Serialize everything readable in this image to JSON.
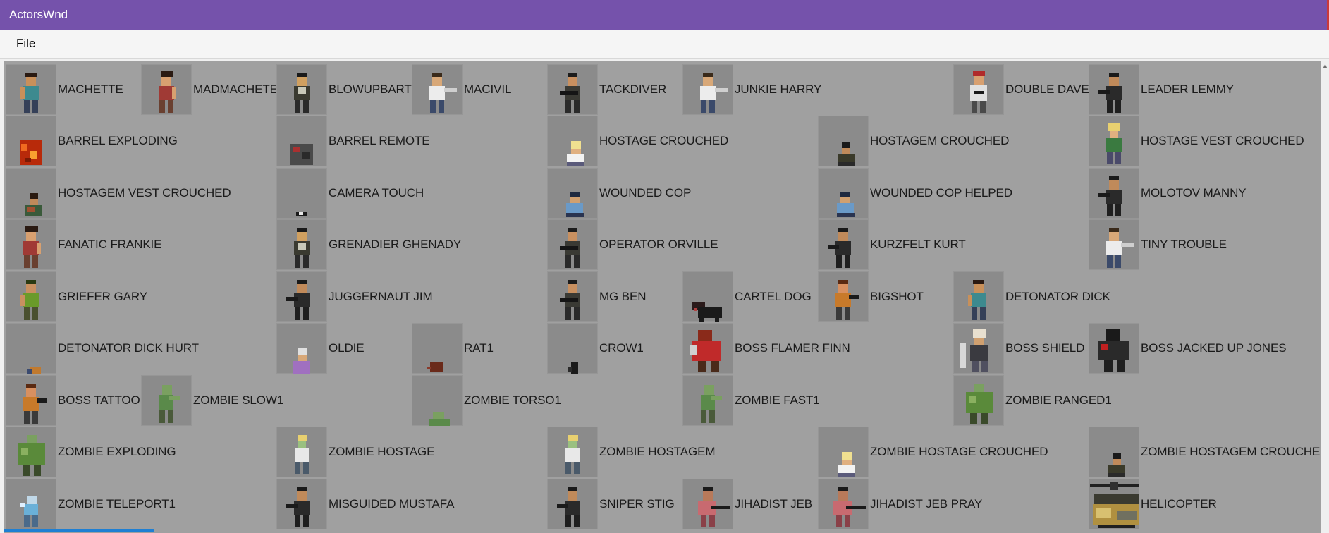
{
  "window": {
    "title": "ActorsWnd"
  },
  "menu": {
    "file_label": "File"
  },
  "actors": [
    {
      "label": "MACHETTE",
      "col": 0,
      "row": 0,
      "look": "guy-teal"
    },
    {
      "label": "MADMACHETE",
      "col": 1,
      "row": 0,
      "look": "guy-red"
    },
    {
      "label": "BLOWUPBART",
      "col": 2,
      "row": 0,
      "look": "guy-vest"
    },
    {
      "label": "MACIVIL",
      "col": 3,
      "row": 0,
      "look": "guy-white"
    },
    {
      "label": "TACKDIVER",
      "col": 4,
      "row": 0,
      "look": "guy-gun"
    },
    {
      "label": "JUNKIE HARRY",
      "col": 5,
      "row": 0,
      "look": "guy-white"
    },
    {
      "label": "DOUBLE DAVE",
      "col": 7,
      "row": 0,
      "look": "guy-cap"
    },
    {
      "label": "LEADER LEMMY",
      "col": 8,
      "row": 0,
      "look": "guy-dark"
    },
    {
      "label": "BARREL EXPLODING",
      "col": 0,
      "row": 1,
      "look": "barrel"
    },
    {
      "label": "BARREL REMOTE",
      "col": 2,
      "row": 1,
      "look": "barrel-remote"
    },
    {
      "label": "HOSTAGE CROUCHED",
      "col": 4,
      "row": 1,
      "look": "crouch-blonde"
    },
    {
      "label": "HOSTAGEM CROUCHED",
      "col": 6,
      "row": 1,
      "look": "crouch-dark"
    },
    {
      "label": "HOSTAGE VEST CROUCHED",
      "col": 8,
      "row": 1,
      "look": "guy-blonde"
    },
    {
      "label": "HOSTAGEM VEST CROUCHED",
      "col": 0,
      "row": 2,
      "look": "crouch-vest"
    },
    {
      "label": "CAMERA TOUCH",
      "col": 2,
      "row": 2,
      "look": "camera"
    },
    {
      "label": "WOUNDED COP",
      "col": 4,
      "row": 2,
      "look": "cop-sit"
    },
    {
      "label": "WOUNDED COP HELPED",
      "col": 6,
      "row": 2,
      "look": "cop-sit"
    },
    {
      "label": "MOLOTOV MANNY",
      "col": 8,
      "row": 2,
      "look": "guy-dark"
    },
    {
      "label": "FANATIC FRANKIE",
      "col": 0,
      "row": 3,
      "look": "guy-red"
    },
    {
      "label": "GRENADIER GHENADY",
      "col": 2,
      "row": 3,
      "look": "guy-vest"
    },
    {
      "label": "OPERATOR ORVILLE",
      "col": 4,
      "row": 3,
      "look": "guy-gun"
    },
    {
      "label": "KURZFELT KURT",
      "col": 6,
      "row": 3,
      "look": "guy-dark"
    },
    {
      "label": "TINY TROUBLE",
      "col": 8,
      "row": 3,
      "look": "guy-white"
    },
    {
      "label": "GRIEFER GARY",
      "col": 0,
      "row": 4,
      "look": "guy-green"
    },
    {
      "label": "JUGGERNAUT JIM",
      "col": 2,
      "row": 4,
      "look": "guy-dark"
    },
    {
      "label": "MG BEN",
      "col": 4,
      "row": 4,
      "look": "guy-gun"
    },
    {
      "label": "CARTEL DOG",
      "col": 5,
      "row": 4,
      "look": "dog"
    },
    {
      "label": "BIGSHOT",
      "col": 6,
      "row": 4,
      "look": "guy-orange"
    },
    {
      "label": "DETONATOR DICK",
      "col": 7,
      "row": 4,
      "look": "guy-teal"
    },
    {
      "label": "DETONATOR DICK HURT",
      "col": 0,
      "row": 5,
      "look": "hurt"
    },
    {
      "label": "OLDIE",
      "col": 2,
      "row": 5,
      "look": "oldie"
    },
    {
      "label": "RAT1",
      "col": 3,
      "row": 5,
      "look": "rat"
    },
    {
      "label": "CROW1",
      "col": 4,
      "row": 5,
      "look": "crow"
    },
    {
      "label": "BOSS FLAMER FINN",
      "col": 5,
      "row": 5,
      "look": "boss-red"
    },
    {
      "label": "BOSS SHIELD",
      "col": 7,
      "row": 5,
      "look": "boss-shield"
    },
    {
      "label": "BOSS JACKED UP JONES",
      "col": 8,
      "row": 5,
      "look": "boss-dark"
    },
    {
      "label": "BOSS TATTOO",
      "col": 0,
      "row": 6,
      "look": "guy-orange"
    },
    {
      "label": "ZOMBIE SLOW1",
      "col": 1,
      "row": 6,
      "look": "zombie"
    },
    {
      "label": "ZOMBIE TORSO1",
      "col": 3,
      "row": 6,
      "look": "zombie-torso"
    },
    {
      "label": "ZOMBIE FAST1",
      "col": 5,
      "row": 6,
      "look": "zombie"
    },
    {
      "label": "ZOMBIE RANGED1",
      "col": 7,
      "row": 6,
      "look": "zombie-fat"
    },
    {
      "label": "ZOMBIE EXPLODING",
      "col": 0,
      "row": 7,
      "look": "zombie-fat"
    },
    {
      "label": "ZOMBIE HOSTAGE",
      "col": 2,
      "row": 7,
      "look": "zombie-blonde"
    },
    {
      "label": "ZOMBIE HOSTAGEM",
      "col": 4,
      "row": 7,
      "look": "zombie-blonde"
    },
    {
      "label": "ZOMBIE HOSTAGE CROUCHED",
      "col": 6,
      "row": 7,
      "look": "crouch-blonde"
    },
    {
      "label": "ZOMBIE HOSTAGEM CROUCHED",
      "col": 8,
      "row": 7,
      "look": "crouch-dark"
    },
    {
      "label": "ZOMBIE TELEPORT1",
      "col": 0,
      "row": 8,
      "look": "zombie-blue"
    },
    {
      "label": "MISGUIDED MUSTAFA",
      "col": 2,
      "row": 8,
      "look": "guy-dark"
    },
    {
      "label": "SNIPER STIG",
      "col": 4,
      "row": 8,
      "look": "guy-dark"
    },
    {
      "label": "JIHADIST JEB",
      "col": 5,
      "row": 8,
      "look": "guy-pink"
    },
    {
      "label": "JIHADIST JEB PRAY",
      "col": 6,
      "row": 8,
      "look": "guy-pink"
    },
    {
      "label": "HELICOPTER",
      "col": 8,
      "row": 8,
      "look": "heli"
    }
  ],
  "looks": {
    "guy-teal": [
      [
        28,
        12,
        16,
        6,
        "#2a1a12"
      ],
      [
        29,
        18,
        14,
        13,
        "#c8905a"
      ],
      [
        25,
        31,
        22,
        20,
        "#3d8a8f"
      ],
      [
        21,
        33,
        6,
        16,
        "#c8905a"
      ],
      [
        26,
        51,
        8,
        18,
        "#354058"
      ],
      [
        38,
        51,
        8,
        18,
        "#354058"
      ]
    ],
    "guy-red": [
      [
        28,
        10,
        18,
        8,
        "#2a1a12"
      ],
      [
        29,
        18,
        14,
        13,
        "#d8a070"
      ],
      [
        25,
        31,
        22,
        20,
        "#a03a35"
      ],
      [
        44,
        33,
        6,
        16,
        "#d8a070"
      ],
      [
        26,
        51,
        8,
        18,
        "#6a4030"
      ],
      [
        38,
        51,
        8,
        18,
        "#6a4030"
      ]
    ],
    "guy-vest": [
      [
        29,
        12,
        14,
        6,
        "#1a1a1a"
      ],
      [
        29,
        18,
        14,
        13,
        "#d0a060"
      ],
      [
        25,
        31,
        22,
        20,
        "#3a3a30"
      ],
      [
        30,
        33,
        12,
        10,
        "#c8c8b8"
      ],
      [
        26,
        51,
        8,
        18,
        "#2a2a2a"
      ],
      [
        38,
        51,
        8,
        18,
        "#2a2a2a"
      ]
    ],
    "guy-white": [
      [
        29,
        12,
        14,
        6,
        "#3a2a1a"
      ],
      [
        29,
        18,
        14,
        13,
        "#d8a878"
      ],
      [
        25,
        31,
        22,
        20,
        "#ececec"
      ],
      [
        46,
        34,
        18,
        5,
        "#cfcfcf"
      ],
      [
        26,
        51,
        8,
        18,
        "#3b4a6a"
      ],
      [
        38,
        51,
        8,
        18,
        "#3b4a6a"
      ]
    ],
    "guy-gun": [
      [
        29,
        12,
        14,
        6,
        "#1c1c1c"
      ],
      [
        29,
        18,
        14,
        13,
        "#c89060"
      ],
      [
        25,
        31,
        22,
        20,
        "#3a3a34"
      ],
      [
        18,
        38,
        26,
        6,
        "#151515"
      ],
      [
        26,
        51,
        8,
        18,
        "#2a2a2a"
      ],
      [
        38,
        51,
        8,
        18,
        "#2a2a2a"
      ]
    ],
    "guy-cap": [
      [
        28,
        10,
        17,
        7,
        "#b02a2a"
      ],
      [
        29,
        17,
        14,
        13,
        "#d8a070"
      ],
      [
        24,
        30,
        24,
        22,
        "#e0e0e0"
      ],
      [
        30,
        38,
        14,
        5,
        "#1a1a1a"
      ],
      [
        26,
        52,
        8,
        17,
        "#4a4a4a"
      ],
      [
        38,
        52,
        8,
        17,
        "#4a4a4a"
      ]
    ],
    "guy-dark": [
      [
        29,
        12,
        14,
        6,
        "#1a1a1a"
      ],
      [
        29,
        18,
        14,
        13,
        "#c08a5a"
      ],
      [
        25,
        31,
        22,
        20,
        "#2a2a2a"
      ],
      [
        14,
        36,
        16,
        6,
        "#1a1a1a"
      ],
      [
        26,
        51,
        8,
        18,
        "#1f1f1f"
      ],
      [
        38,
        51,
        8,
        18,
        "#1f1f1f"
      ]
    ],
    "guy-green": [
      [
        29,
        12,
        14,
        6,
        "#2a3a12"
      ],
      [
        29,
        18,
        14,
        13,
        "#c89060"
      ],
      [
        25,
        31,
        22,
        20,
        "#6a9a2a"
      ],
      [
        21,
        33,
        6,
        16,
        "#c89060"
      ],
      [
        26,
        51,
        8,
        18,
        "#4a5030"
      ],
      [
        38,
        51,
        8,
        18,
        "#4a5030"
      ]
    ],
    "guy-orange": [
      [
        29,
        12,
        14,
        6,
        "#5a2a12"
      ],
      [
        29,
        18,
        14,
        13,
        "#d89060"
      ],
      [
        25,
        31,
        22,
        20,
        "#c87a2a"
      ],
      [
        44,
        33,
        14,
        6,
        "#1a1a1a"
      ],
      [
        26,
        51,
        8,
        18,
        "#3a3a3a"
      ],
      [
        38,
        51,
        8,
        18,
        "#3a3a3a"
      ]
    ],
    "guy-blonde": [
      [
        28,
        10,
        16,
        12,
        "#e8d070"
      ],
      [
        30,
        22,
        12,
        10,
        "#e0b080"
      ],
      [
        25,
        32,
        22,
        19,
        "#3a7a40"
      ],
      [
        26,
        51,
        8,
        18,
        "#4a4a6a"
      ],
      [
        38,
        51,
        8,
        18,
        "#4a4a6a"
      ]
    ],
    "guy-pink": [
      [
        29,
        12,
        14,
        6,
        "#1a1a1a"
      ],
      [
        29,
        18,
        14,
        13,
        "#b87a5a"
      ],
      [
        22,
        31,
        26,
        20,
        "#c86a70"
      ],
      [
        40,
        38,
        28,
        5,
        "#1a1a1a"
      ],
      [
        26,
        51,
        8,
        18,
        "#8a4048"
      ],
      [
        38,
        51,
        8,
        18,
        "#8a4048"
      ]
    ],
    "crouch-blonde": [
      [
        34,
        36,
        14,
        12,
        "#f0e090"
      ],
      [
        34,
        48,
        14,
        8,
        "#e0b080"
      ],
      [
        28,
        54,
        24,
        14,
        "#f2f2f2"
      ],
      [
        28,
        66,
        24,
        5,
        "#5a5a7a"
      ]
    ],
    "crouch-dark": [
      [
        34,
        38,
        12,
        8,
        "#1a1a1a"
      ],
      [
        34,
        46,
        12,
        8,
        "#c08a5a"
      ],
      [
        28,
        54,
        24,
        14,
        "#3a3a2a"
      ],
      [
        28,
        66,
        24,
        5,
        "#2a2a2a"
      ]
    ],
    "crouch-vest": [
      [
        34,
        36,
        12,
        8,
        "#2a1a10"
      ],
      [
        34,
        44,
        12,
        9,
        "#c08a5a"
      ],
      [
        28,
        53,
        24,
        15,
        "#3a5a3a"
      ],
      [
        30,
        55,
        12,
        7,
        "#a05030"
      ]
    ],
    "cop-sit": [
      [
        32,
        34,
        14,
        7,
        "#1f2a40"
      ],
      [
        32,
        41,
        14,
        9,
        "#d0a070"
      ],
      [
        27,
        50,
        24,
        14,
        "#6a9ac8"
      ],
      [
        27,
        64,
        26,
        6,
        "#2a3450"
      ]
    ],
    "barrel": [
      [
        20,
        34,
        32,
        36,
        "#b82a0a"
      ],
      [
        22,
        40,
        8,
        10,
        "#f06a20"
      ],
      [
        34,
        50,
        10,
        12,
        "#f8a030"
      ],
      [
        28,
        60,
        8,
        6,
        "#7a1a05"
      ]
    ],
    "barrel-remote": [
      [
        20,
        40,
        32,
        30,
        "#4a4a4a"
      ],
      [
        24,
        44,
        10,
        8,
        "#aa3030"
      ],
      [
        36,
        52,
        12,
        10,
        "#2a2a2a"
      ]
    ],
    "camera": [
      [
        28,
        62,
        16,
        6,
        "#1a1a1a"
      ],
      [
        32,
        63,
        6,
        4,
        "#e8e8e8"
      ]
    ],
    "dog": [
      [
        14,
        44,
        18,
        10,
        "#2a1a1a"
      ],
      [
        22,
        50,
        34,
        16,
        "#1a1a1a"
      ],
      [
        24,
        64,
        6,
        8,
        "#1a1a1a"
      ],
      [
        46,
        64,
        6,
        8,
        "#1a1a1a"
      ],
      [
        16,
        52,
        5,
        4,
        "#b04040"
      ]
    ],
    "hurt": [
      [
        34,
        62,
        16,
        10,
        "#c07a30"
      ],
      [
        30,
        66,
        8,
        6,
        "#3a4a70"
      ]
    ],
    "oldie": [
      [
        30,
        36,
        14,
        10,
        "#e0e0e0"
      ],
      [
        30,
        46,
        14,
        8,
        "#d8a878"
      ],
      [
        24,
        54,
        24,
        18,
        "#a070c0"
      ]
    ],
    "rat": [
      [
        26,
        56,
        18,
        14,
        "#6a2a1a"
      ],
      [
        22,
        62,
        6,
        4,
        "#8a3a2a"
      ]
    ],
    "crow": [
      [
        34,
        56,
        10,
        16,
        "#1a1a1a"
      ],
      [
        30,
        62,
        6,
        8,
        "#2a2a2a"
      ]
    ],
    "boss-red": [
      [
        22,
        10,
        20,
        16,
        "#8a2a1a"
      ],
      [
        14,
        26,
        40,
        28,
        "#c02a2a"
      ],
      [
        10,
        32,
        10,
        14,
        "#d0d0d0"
      ],
      [
        22,
        54,
        12,
        16,
        "#4a2a1a"
      ],
      [
        40,
        54,
        12,
        16,
        "#4a2a1a"
      ]
    ],
    "boss-shield": [
      [
        28,
        8,
        18,
        14,
        "#e8e0d0"
      ],
      [
        30,
        22,
        14,
        10,
        "#d0a070"
      ],
      [
        24,
        32,
        26,
        22,
        "#3a3a40"
      ],
      [
        10,
        28,
        8,
        36,
        "#d8d8d8"
      ],
      [
        26,
        54,
        10,
        16,
        "#505060"
      ],
      [
        40,
        54,
        10,
        16,
        "#505060"
      ]
    ],
    "boss-dark": [
      [
        24,
        8,
        20,
        18,
        "#1a1a1a"
      ],
      [
        14,
        26,
        44,
        26,
        "#2a2a2a"
      ],
      [
        18,
        30,
        10,
        8,
        "#c02020"
      ],
      [
        22,
        52,
        12,
        18,
        "#1f1f1f"
      ],
      [
        40,
        52,
        12,
        18,
        "#1f1f1f"
      ]
    ],
    "zombie": [
      [
        30,
        14,
        14,
        14,
        "#7aa060"
      ],
      [
        26,
        28,
        20,
        22,
        "#5a8a4a"
      ],
      [
        40,
        30,
        16,
        5,
        "#7aa060"
      ],
      [
        26,
        50,
        8,
        18,
        "#4a5a3a"
      ],
      [
        38,
        50,
        8,
        18,
        "#4a5a3a"
      ]
    ],
    "zombie-torso": [
      [
        30,
        52,
        16,
        12,
        "#7aa060"
      ],
      [
        24,
        62,
        30,
        10,
        "#5a8a4a"
      ]
    ],
    "zombie-fat": [
      [
        30,
        12,
        14,
        12,
        "#7aa060"
      ],
      [
        18,
        24,
        38,
        30,
        "#5a8a3a"
      ],
      [
        22,
        30,
        10,
        10,
        "#8ab060"
      ],
      [
        24,
        54,
        10,
        16,
        "#3a4a2a"
      ],
      [
        40,
        54,
        10,
        16,
        "#3a4a2a"
      ]
    ],
    "zombie-blonde": [
      [
        30,
        12,
        14,
        8,
        "#e8d070"
      ],
      [
        30,
        20,
        12,
        10,
        "#9ac080"
      ],
      [
        26,
        30,
        20,
        20,
        "#e8e8e8"
      ],
      [
        26,
        50,
        8,
        18,
        "#4a5a6a"
      ],
      [
        38,
        50,
        8,
        18,
        "#4a5a6a"
      ]
    ],
    "zombie-blue": [
      [
        30,
        24,
        14,
        12,
        "#c0d8e8"
      ],
      [
        26,
        36,
        20,
        16,
        "#6ab0d8"
      ],
      [
        20,
        34,
        8,
        6,
        "#e0f0ff"
      ],
      [
        26,
        52,
        8,
        16,
        "#4a6a8a"
      ],
      [
        38,
        52,
        8,
        16,
        "#4a6a8a"
      ]
    ],
    "heli": [
      [
        2,
        8,
        70,
        4,
        "#202020"
      ],
      [
        30,
        4,
        12,
        12,
        "#303030"
      ],
      [
        8,
        22,
        64,
        14,
        "#3a3a30"
      ],
      [
        6,
        36,
        66,
        30,
        "#b09040"
      ],
      [
        10,
        42,
        22,
        14,
        "#d8c070"
      ],
      [
        40,
        46,
        28,
        12,
        "#707060"
      ],
      [
        14,
        66,
        52,
        4,
        "#202020"
      ]
    ]
  }
}
